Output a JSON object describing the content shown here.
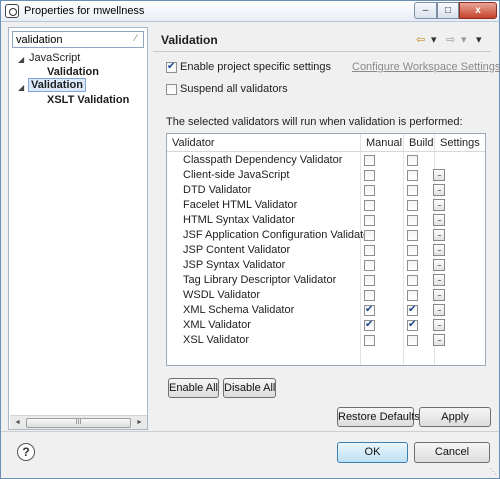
{
  "window": {
    "title": "Properties for mwellness"
  },
  "window_controls": {
    "minimize": "–",
    "maximize": "□",
    "close": "x"
  },
  "filter": {
    "value": "validation",
    "clear_icon": "∕"
  },
  "tree": {
    "items": [
      {
        "label": "JavaScript",
        "expanded": true
      },
      {
        "label": "Validation"
      },
      {
        "label": "Validation",
        "expanded": true,
        "selected": true
      },
      {
        "label": "XSLT Validation"
      }
    ]
  },
  "page": {
    "title": "Validation",
    "nav": {
      "back": "⇦",
      "back_menu": "▾",
      "forward": "⇨",
      "forward_menu": "▾",
      "view_menu": "▾"
    },
    "enable_project_settings": {
      "label": "Enable project specific settings",
      "checked": true
    },
    "configure_link": "Configure Workspace Settings...",
    "suspend_all": {
      "label": "Suspend all validators",
      "checked": false
    },
    "description": "The selected validators will run when validation is performed:"
  },
  "table": {
    "headers": {
      "validator": "Validator",
      "manual": "Manual",
      "build": "Build",
      "settings": "Settings"
    },
    "settings_button": "...",
    "rows": [
      {
        "name": "Classpath Dependency Validator",
        "manual": false,
        "build": false,
        "settings": false
      },
      {
        "name": "Client-side JavaScript",
        "manual": false,
        "build": false,
        "settings": true
      },
      {
        "name": "DTD Validator",
        "manual": false,
        "build": false,
        "settings": true
      },
      {
        "name": "Facelet HTML Validator",
        "manual": false,
        "build": false,
        "settings": true
      },
      {
        "name": "HTML Syntax Validator",
        "manual": false,
        "build": false,
        "settings": true
      },
      {
        "name": "JSF Application Configuration Validator",
        "manual": false,
        "build": false,
        "settings": true
      },
      {
        "name": "JSP Content Validator",
        "manual": false,
        "build": false,
        "settings": true
      },
      {
        "name": "JSP Syntax Validator",
        "manual": false,
        "build": false,
        "settings": true
      },
      {
        "name": "Tag Library Descriptor Validator",
        "manual": false,
        "build": false,
        "settings": true
      },
      {
        "name": "WSDL Validator",
        "manual": false,
        "build": false,
        "settings": true
      },
      {
        "name": "XML Schema Validator",
        "manual": true,
        "build": true,
        "settings": true
      },
      {
        "name": "XML Validator",
        "manual": true,
        "build": true,
        "settings": true
      },
      {
        "name": "XSL Validator",
        "manual": false,
        "build": false,
        "settings": true
      }
    ]
  },
  "buttons": {
    "enable_all": "Enable All",
    "disable_all": "Disable All",
    "restore_defaults": "Restore Defaults",
    "apply": "Apply",
    "ok": "OK",
    "cancel": "Cancel"
  },
  "scrollbar": {
    "left": "◄",
    "thumb": "III",
    "right": "►"
  },
  "help": {
    "icon": "?"
  }
}
